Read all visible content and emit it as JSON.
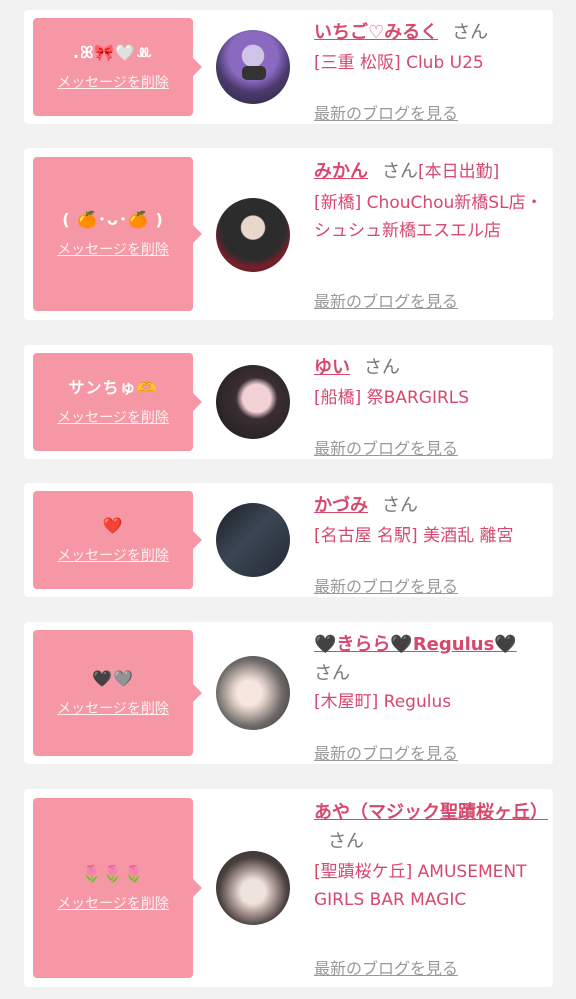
{
  "delete_label": "メッセージを削除",
  "blog_label": "最新のブログを見る",
  "san": "さん",
  "colors": {
    "accent": "#d7486d",
    "bubble": "#f697a5",
    "background": "#f2f2f2"
  },
  "cards": [
    {
      "message": ".ꕤ🎀🤍ꔛ",
      "name": "いちご♡みるく",
      "tag": "",
      "shop": "[三重 松阪] Club U25"
    },
    {
      "message": "( 🍊･ᴗ･🍊 )",
      "name": "みかん",
      "tag": "[本日出勤]",
      "shop": "[新橋] ChouChou新橋SL店・シュシュ新橋エスエル店"
    },
    {
      "message": "サンちゅ🫶",
      "name": "ゆい",
      "tag": "",
      "shop": "[船橋] 祭BARGIRLS"
    },
    {
      "message": "❤️",
      "name": "かづみ",
      "tag": "",
      "shop": "[名古屋 名駅] 美酒乱 離宮"
    },
    {
      "message": "🖤🩶",
      "name": "🖤きらら🖤Regulus🖤",
      "tag": "",
      "shop": "[木屋町] Regulus"
    },
    {
      "message": "🌷🌷🌷",
      "name": "あや（マジック聖蹟桜ヶ丘）",
      "tag": "",
      "shop": "[聖蹟桜ケ丘] AMUSEMENT GIRLS BAR MAGIC"
    }
  ]
}
